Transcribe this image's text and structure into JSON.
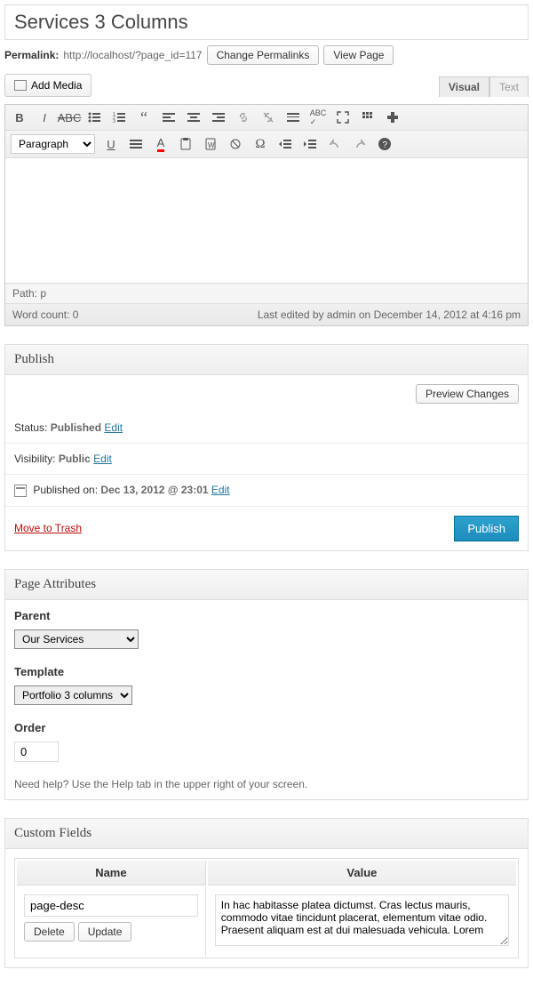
{
  "title": "Services 3 Columns",
  "permalink": {
    "label": "Permalink:",
    "url": "http://localhost/?page_id=117",
    "change_btn": "Change Permalinks",
    "view_btn": "View Page"
  },
  "media": {
    "add_btn": "Add Media"
  },
  "tabs": {
    "visual": "Visual",
    "text": "Text"
  },
  "format_select": "Paragraph",
  "editor": {
    "path": "Path: p",
    "word_count": "Word count: 0",
    "last_edit": "Last edited by admin on December 14, 2012 at 4:16 pm"
  },
  "publish": {
    "title": "Publish",
    "preview_btn": "Preview Changes",
    "status_label": "Status:",
    "status_value": "Published",
    "visibility_label": "Visibility:",
    "visibility_value": "Public",
    "pubdate_label": "Published on:",
    "pubdate_value": "Dec 13, 2012 @ 23:01",
    "edit_link": "Edit",
    "trash_link": "Move to Trash",
    "publish_btn": "Publish"
  },
  "attributes": {
    "title": "Page Attributes",
    "parent_label": "Parent",
    "parent_value": "Our Services",
    "template_label": "Template",
    "template_value": "Portfolio 3 columns",
    "order_label": "Order",
    "order_value": "0",
    "help": "Need help? Use the Help tab in the upper right of your screen."
  },
  "custom_fields": {
    "title": "Custom Fields",
    "name_header": "Name",
    "value_header": "Value",
    "name_value": "page-desc",
    "value_text": "In hac habitasse platea dictumst. Cras lectus mauris, commodo vitae tincidunt placerat, elementum vitae odio. Praesent aliquam est at dui malesuada vehicula. Lorem",
    "delete_btn": "Delete",
    "update_btn": "Update"
  }
}
